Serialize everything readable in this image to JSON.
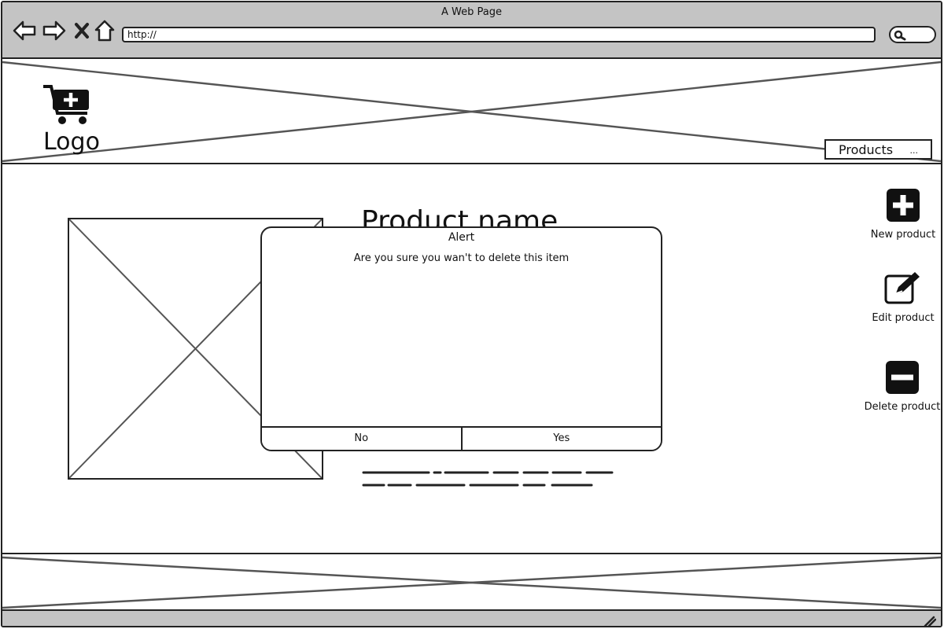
{
  "browser": {
    "title": "A Web Page",
    "url": "http://",
    "icons": {
      "back": "back-arrow-icon",
      "forward": "forward-arrow-icon",
      "stop": "close-icon",
      "home": "home-icon",
      "search": "search-icon"
    }
  },
  "header": {
    "logo_text": "Logo",
    "logo_icon": "cart-plus-icon",
    "menu_label": "Products",
    "menu_more": "..."
  },
  "product": {
    "name": "Product name"
  },
  "actions": {
    "new_label": "New product",
    "edit_label": "Edit product",
    "delete_label": "Delete product"
  },
  "alert": {
    "title": "Alert",
    "message": "Are you sure you wan't to delete this item",
    "no_label": "No",
    "yes_label": "Yes"
  },
  "colors": {
    "chrome": "#c4c4c4",
    "ink": "#222222",
    "placeholder_line": "#555555"
  }
}
